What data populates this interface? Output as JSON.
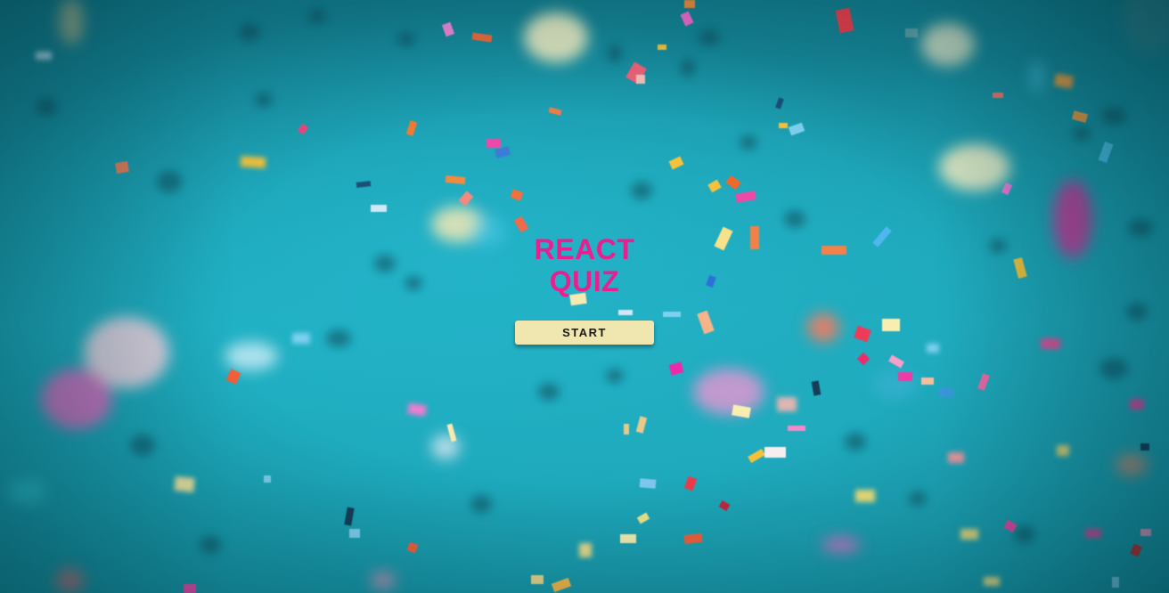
{
  "app": {
    "title_line1": "REACT",
    "title_line2": "QUIZ",
    "start_label": "START",
    "accent_color": "#ec1d8f",
    "button_color": "#efe6b0",
    "background": "confetti-on-teal"
  }
}
